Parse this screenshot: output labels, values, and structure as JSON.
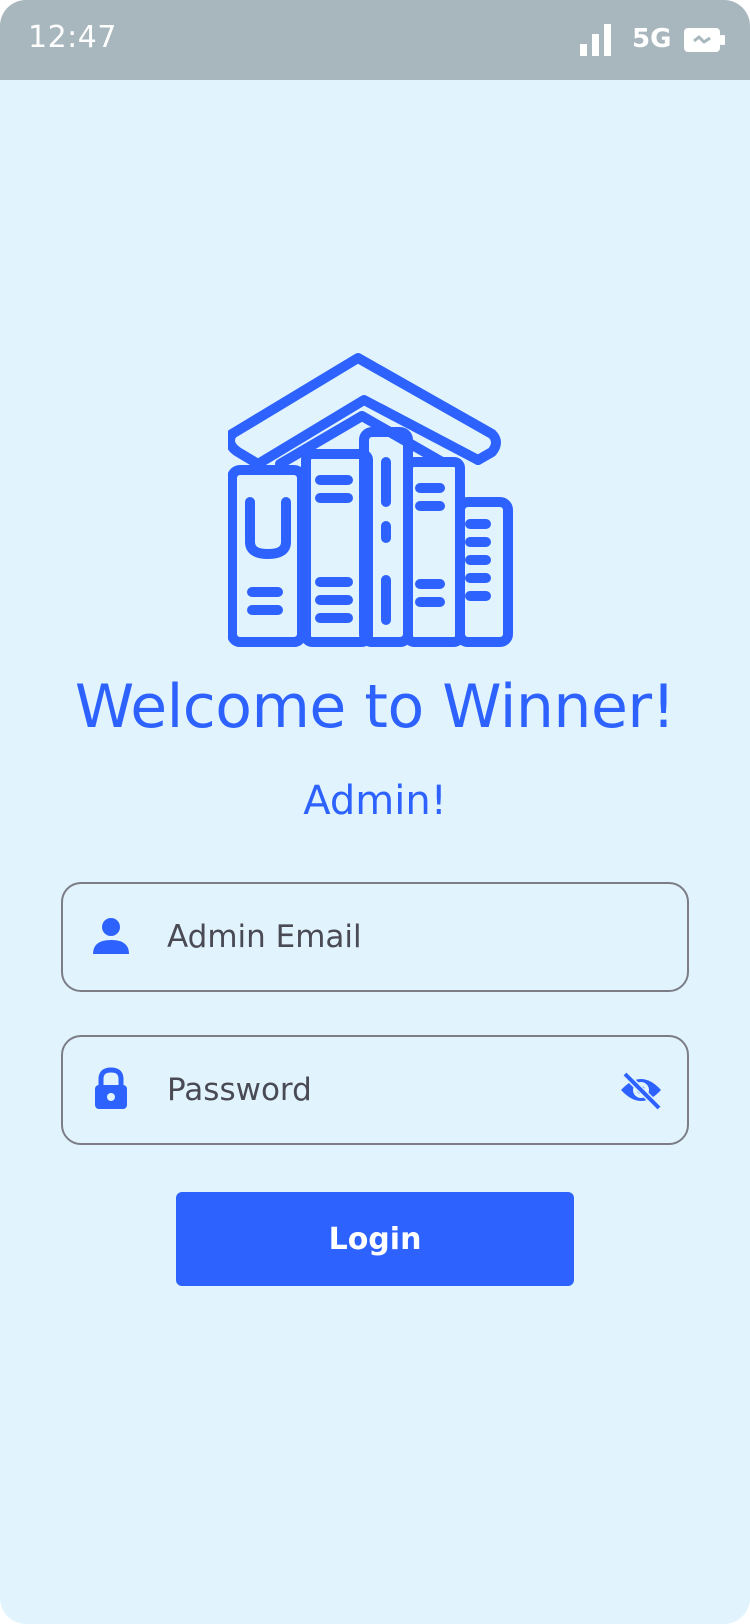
{
  "status_bar": {
    "time": "12:47",
    "network": "5G",
    "icons": [
      "signal-icon",
      "battery-icon"
    ]
  },
  "logo": {
    "icon": "library-books-icon",
    "color": "#2d62ff"
  },
  "welcome": {
    "title": "Welcome to Winner!",
    "subtitle": "Admin!"
  },
  "form": {
    "email": {
      "placeholder": "Admin Email",
      "value": "",
      "icon": "person-icon"
    },
    "password": {
      "placeholder": "Password",
      "value": "",
      "icon": "lock-icon",
      "toggle_icon": "eye-off-icon"
    },
    "login_label": "Login"
  },
  "colors": {
    "accent": "#2d62ff",
    "background": "#e1f4fd",
    "status_bar": "#a8b7be",
    "field_border": "#7c7d86"
  }
}
